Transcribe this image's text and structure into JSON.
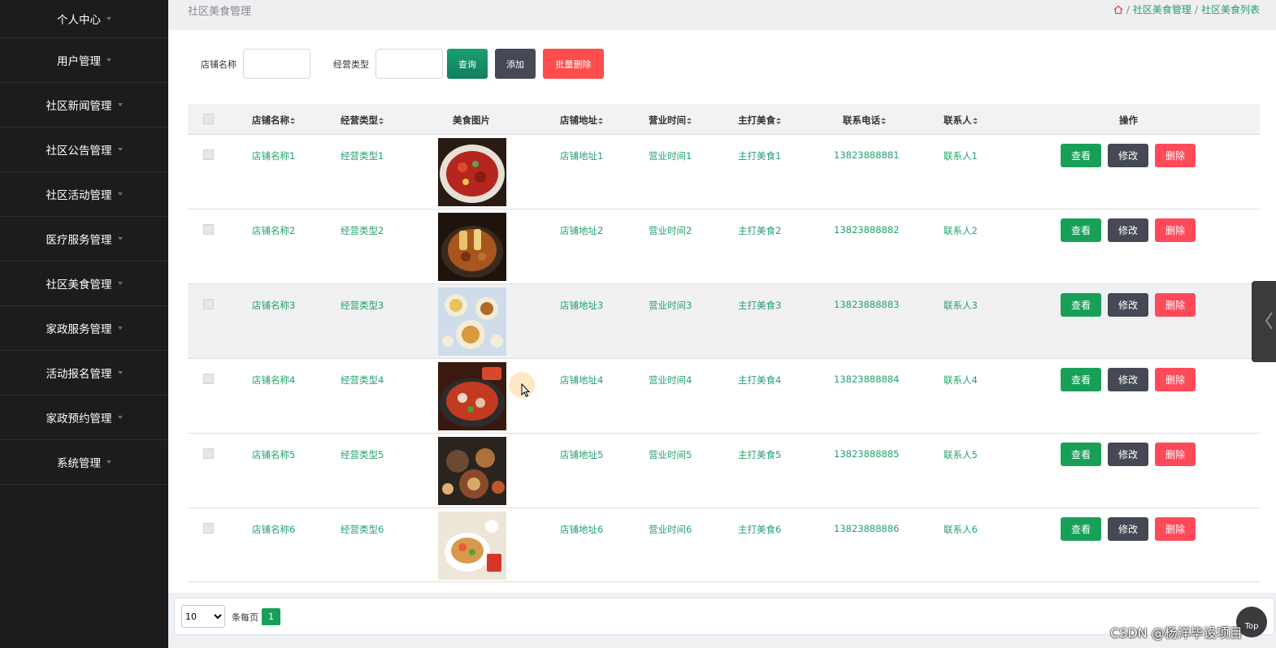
{
  "sidebar": {
    "items": [
      {
        "label": "个人中心"
      },
      {
        "label": "用户管理"
      },
      {
        "label": "社区新闻管理"
      },
      {
        "label": "社区公告管理"
      },
      {
        "label": "社区活动管理"
      },
      {
        "label": "医疗服务管理"
      },
      {
        "label": "社区美食管理"
      },
      {
        "label": "家政服务管理"
      },
      {
        "label": "活动报名管理"
      },
      {
        "label": "家政预约管理"
      },
      {
        "label": "系统管理"
      }
    ]
  },
  "header": {
    "title": "社区美食管理",
    "home_icon": "home-icon",
    "breadcrumb": [
      "社区美食管理",
      "社区美食列表"
    ],
    "separator": "/"
  },
  "search": {
    "store_name_label": "店铺名称",
    "store_name_value": "",
    "business_type_label": "经营类型",
    "business_type_value": "",
    "query_label": "查询",
    "add_label": "添加",
    "batch_delete_label": "批量删除"
  },
  "table": {
    "headers": [
      "店铺名称",
      "经营类型",
      "美食图片",
      "店铺地址",
      "营业时间",
      "主打美食",
      "联系电话",
      "联系人",
      "操作"
    ],
    "view_label": "查看",
    "edit_label": "修改",
    "delete_label": "删除",
    "rows": [
      {
        "name": "店铺名称1",
        "type": "经营类型1",
        "address": "店铺地址1",
        "hours": "营业时间1",
        "dish": "主打美食1",
        "phone": "13823888881",
        "contact": "联系人1"
      },
      {
        "name": "店铺名称2",
        "type": "经营类型2",
        "address": "店铺地址2",
        "hours": "营业时间2",
        "dish": "主打美食2",
        "phone": "13823888882",
        "contact": "联系人2"
      },
      {
        "name": "店铺名称3",
        "type": "经营类型3",
        "address": "店铺地址3",
        "hours": "营业时间3",
        "dish": "主打美食3",
        "phone": "13823888883",
        "contact": "联系人3"
      },
      {
        "name": "店铺名称4",
        "type": "经营类型4",
        "address": "店铺地址4",
        "hours": "营业时间4",
        "dish": "主打美食4",
        "phone": "13823888884",
        "contact": "联系人4"
      },
      {
        "name": "店铺名称5",
        "type": "经营类型5",
        "address": "店铺地址5",
        "hours": "营业时间5",
        "dish": "主打美食5",
        "phone": "13823888885",
        "contact": "联系人5"
      },
      {
        "name": "店铺名称6",
        "type": "经营类型6",
        "address": "店铺地址6",
        "hours": "营业时间6",
        "dish": "主打美食6",
        "phone": "13823888886",
        "contact": "联系人6"
      }
    ]
  },
  "pager": {
    "page_size": "10",
    "page_size_options": [
      "10"
    ],
    "per_page_label": "条每页",
    "current_page": "1"
  },
  "top_button_label": "Top",
  "watermark": "CSDN @杨洋毕设项目",
  "colors": {
    "sidebar_bg": "#1c1c1e",
    "accent_green": "#18a058",
    "link_green": "#23a26a",
    "danger": "#ff4a5a",
    "dark_button": "#454955"
  }
}
